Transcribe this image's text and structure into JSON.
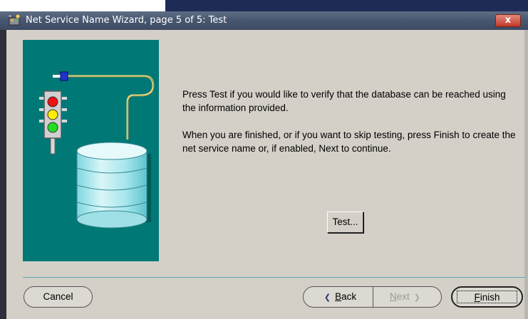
{
  "window": {
    "title": "Net Service Name Wizard, page 5 of 5: Test",
    "close_label": "x"
  },
  "content": {
    "paragraph1": "Press Test if you would like to verify that the database can be reached using the information provided.",
    "paragraph2": "When you are finished, or if you want to skip testing, press Finish to create the net service name or, if enabled, Next to continue."
  },
  "buttons": {
    "test": "Test...",
    "cancel": "Cancel",
    "back_mnemonic": "B",
    "back_rest": "ack",
    "next_mnemonic": "N",
    "next_rest": "ext",
    "finish_mnemonic": "F",
    "finish_rest": "inish"
  },
  "state": {
    "next_enabled": false
  },
  "colors": {
    "illustration_bg": "#007876",
    "separator": "#5ba7b5",
    "titlebar": "#495871",
    "close_button": "#c2392a"
  },
  "icons": {
    "title": "wizard-app-icon",
    "back": "chevron-left-icon",
    "next": "chevron-right-icon"
  }
}
